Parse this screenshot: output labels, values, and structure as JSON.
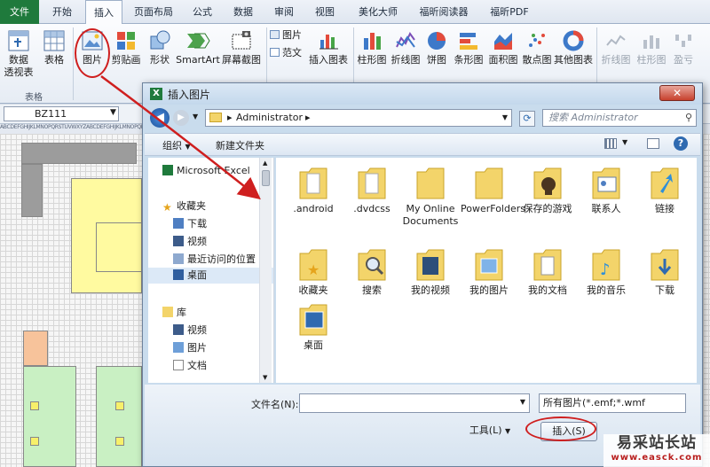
{
  "ribbon": {
    "tabs": [
      "文件",
      "开始",
      "插入",
      "页面布局",
      "公式",
      "数据",
      "审阅",
      "视图",
      "美化大师",
      "福昕阅读器",
      "福昕PDF"
    ],
    "active_tab": "插入",
    "buttons": {
      "pivot_line1": "数据",
      "pivot_line2": "透视表",
      "table": "表格",
      "picture": "图片",
      "clipart": "剪贴画",
      "shapes": "形状",
      "smartart": "SmartArt",
      "screenshot": "屏幕截图",
      "chart_picture": "图片",
      "chart_text": "范文",
      "insert_chart": "插入图表",
      "column": "柱形图",
      "line": "折线图",
      "pie": "饼图",
      "bar": "条形图",
      "area": "面积图",
      "scatter": "散点图",
      "other_charts": "其他图表",
      "spark_line": "折线图",
      "spark_column": "柱形图",
      "spark_winloss": "盈亏"
    },
    "group_labels": {
      "tables": "表格"
    }
  },
  "namebox": {
    "value": "BZ111"
  },
  "colheader_text": "ABCDEFGHIJKLMNOPQRSTUVWXYZABCDEFGHIJKLMNOPQRSTUVWXYZ",
  "dialog": {
    "title": "插入图片",
    "close": "✕",
    "address": "Administrator",
    "search_placeholder": "搜索 Administrator",
    "organize": "组织",
    "new_folder": "新建文件夹",
    "nav_items": [
      "Microsoft Excel",
      "收藏夹",
      "下载",
      "视频",
      "最近访问的位置",
      "桌面",
      "库",
      "视频",
      "图片",
      "文档"
    ],
    "files": [
      ".android",
      ".dvdcss",
      "My Online Documents",
      "PowerFolders",
      "保存的游戏",
      "联系人",
      "链接",
      "收藏夹",
      "搜索",
      "我的视频",
      "我的图片",
      "我的文档",
      "我的音乐",
      "下载",
      "桌面"
    ],
    "filename_label": "文件名(N):",
    "filetype_value": "所有图片(*.emf;*.wmf",
    "tools_button": "工具(L)",
    "insert_button": "插入(S)"
  },
  "watermark": {
    "line1": "易采站长站",
    "line2": "www.easck.com"
  },
  "colors": {
    "file_tab": "#1f7a3c",
    "annotation": "#cf1f1f",
    "folder": "#f3d46a"
  }
}
